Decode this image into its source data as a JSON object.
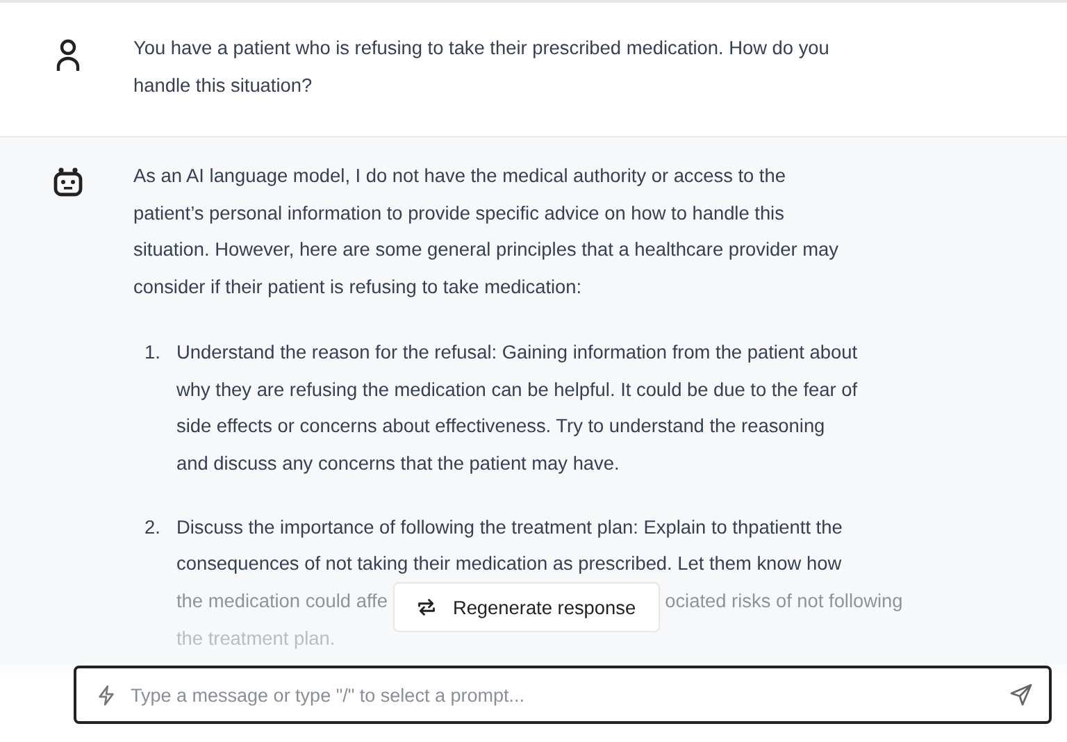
{
  "user_message": {
    "lines": [
      "You have a patient who is refusing to take their prescribed medication. How do you",
      "handle this situation?"
    ]
  },
  "assistant_message": {
    "intro_lines": [
      "As an AI language model, I do not have the medical authority or access to the",
      "patient’s personal information to provide specific advice on how to handle this",
      "situation. However, here are some general principles that a healthcare provider may",
      "consider if their patient is refusing to take medication:"
    ],
    "items": [
      {
        "number": "1.",
        "lines": [
          [
            "Understand the reason for the refusal: Gaining information from the patient about"
          ],
          [
            "why they are refusing the medication can be helpful. It could be due to the fear of"
          ],
          [
            "side effects or concerns about effectiveness. Try to understand the reasoning"
          ],
          [
            "and discuss any concerns that the patient may have."
          ]
        ]
      },
      {
        "number": "2.",
        "lines": [
          [
            "Discuss the importance of following the treatment plan: Explain to thpatientt the"
          ],
          [
            "consequences of not taking their medication as prescribed. Let them know how"
          ],
          [
            "the medication could affe",
            "ociated risks of not following"
          ],
          [
            "the treatment plan."
          ]
        ]
      }
    ]
  },
  "regenerate_button": {
    "label": "Regenerate response"
  },
  "composer": {
    "placeholder": "Type a message or type \"/\" to select a prompt..."
  }
}
